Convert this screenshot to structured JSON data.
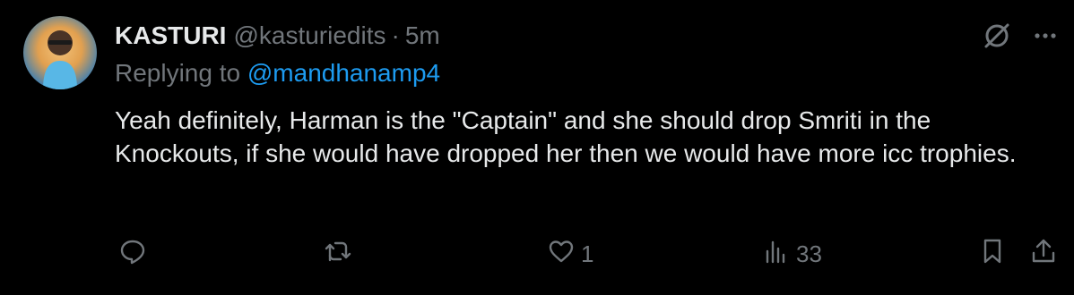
{
  "tweet": {
    "author_name": "KASTURI",
    "handle": "@kasturiedits",
    "separator": "·",
    "time": "5m",
    "replying_prefix": "Replying to ",
    "replying_to": "@mandhanamp4",
    "text": "Yeah definitely, Harman is the \"Captain\" and she should drop Smriti in the Knockouts, if she would have dropped her then we would have more icc trophies.",
    "likes": "1",
    "views": "33"
  },
  "icons": {
    "top": [
      "mute-icon",
      "more-icon"
    ],
    "actions": [
      "reply-icon",
      "retweet-icon",
      "like-icon",
      "views-icon",
      "bookmark-icon",
      "share-icon"
    ]
  },
  "colors": {
    "background": "#000000",
    "text": "#e7e9ea",
    "secondary": "#71767b",
    "link": "#1d9bf0"
  }
}
